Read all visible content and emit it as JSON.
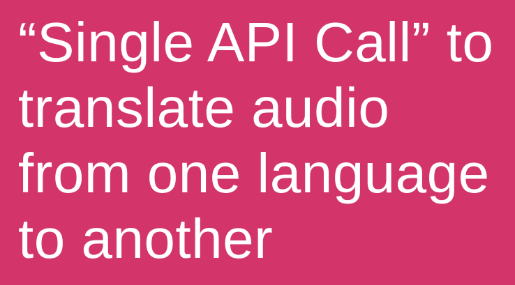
{
  "slide": {
    "background_color": "#d3356a",
    "text_color": "#ffffff",
    "headline_lines": [
      "“Single API Call” to",
      "translate audio",
      "from one language",
      "to another"
    ]
  }
}
